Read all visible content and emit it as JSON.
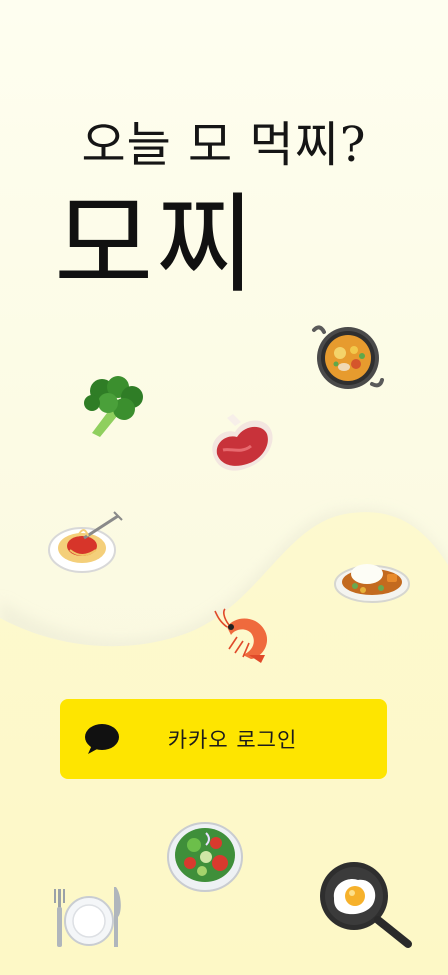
{
  "app": {
    "tagline": "오늘 모 먹찌?",
    "logo_text": "모찌"
  },
  "login": {
    "button_label": "카카오 로그인"
  },
  "colors": {
    "background": "#fdfde9",
    "wave": "#fdf8c9",
    "kakao_yellow": "#fee500",
    "kakao_text": "#1b1b1b"
  },
  "decorations": [
    "paella-pan-icon",
    "broccoli-icon",
    "steak-icon",
    "spaghetti-icon",
    "curry-rice-icon",
    "shrimp-icon",
    "salad-icon",
    "fork-knife-plate-icon",
    "fried-egg-pan-icon"
  ]
}
